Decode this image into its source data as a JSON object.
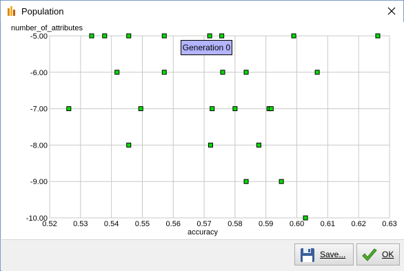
{
  "window": {
    "title": "Population"
  },
  "chart_data": {
    "type": "scatter",
    "title": "",
    "xlabel": "accuracy",
    "ylabel": "number_of_attributes",
    "xlim": [
      0.52,
      0.63
    ],
    "ylim": [
      -10.0,
      -5.0
    ],
    "x_ticks": [
      "0.52",
      "0.53",
      "0.54",
      "0.55",
      "0.56",
      "0.57",
      "0.58",
      "0.59",
      "0.60",
      "0.61",
      "0.62",
      "0.63"
    ],
    "y_ticks": [
      "-5.00",
      "-6.00",
      "-7.00",
      "-8.00",
      "-9.00",
      "-10.00"
    ],
    "grid": true,
    "marker_color": "#00dd00",
    "annotation": "Generation 0",
    "points": [
      {
        "x": 0.5336,
        "y": -5
      },
      {
        "x": 0.5378,
        "y": -5
      },
      {
        "x": 0.5456,
        "y": -5
      },
      {
        "x": 0.5571,
        "y": -5
      },
      {
        "x": 0.5718,
        "y": -5
      },
      {
        "x": 0.5757,
        "y": -5
      },
      {
        "x": 0.599,
        "y": -5
      },
      {
        "x": 0.6262,
        "y": -5
      },
      {
        "x": 0.5418,
        "y": -6
      },
      {
        "x": 0.5571,
        "y": -6
      },
      {
        "x": 0.576,
        "y": -6
      },
      {
        "x": 0.5836,
        "y": -6
      },
      {
        "x": 0.6066,
        "y": -6
      },
      {
        "x": 0.5262,
        "y": -7
      },
      {
        "x": 0.5495,
        "y": -7
      },
      {
        "x": 0.5726,
        "y": -7
      },
      {
        "x": 0.58,
        "y": -7
      },
      {
        "x": 0.591,
        "y": -7
      },
      {
        "x": 0.5917,
        "y": -7
      },
      {
        "x": 0.5456,
        "y": -8
      },
      {
        "x": 0.5721,
        "y": -8
      },
      {
        "x": 0.5877,
        "y": -8
      },
      {
        "x": 0.5836,
        "y": -9
      },
      {
        "x": 0.595,
        "y": -9
      },
      {
        "x": 0.6028,
        "y": -10
      }
    ]
  },
  "buttons": {
    "save_label": "Save...",
    "ok_label": "OK"
  },
  "icons": {
    "app": "chart-app-icon",
    "close": "close-icon",
    "save": "floppy-disk-icon",
    "ok": "checkmark-icon"
  }
}
